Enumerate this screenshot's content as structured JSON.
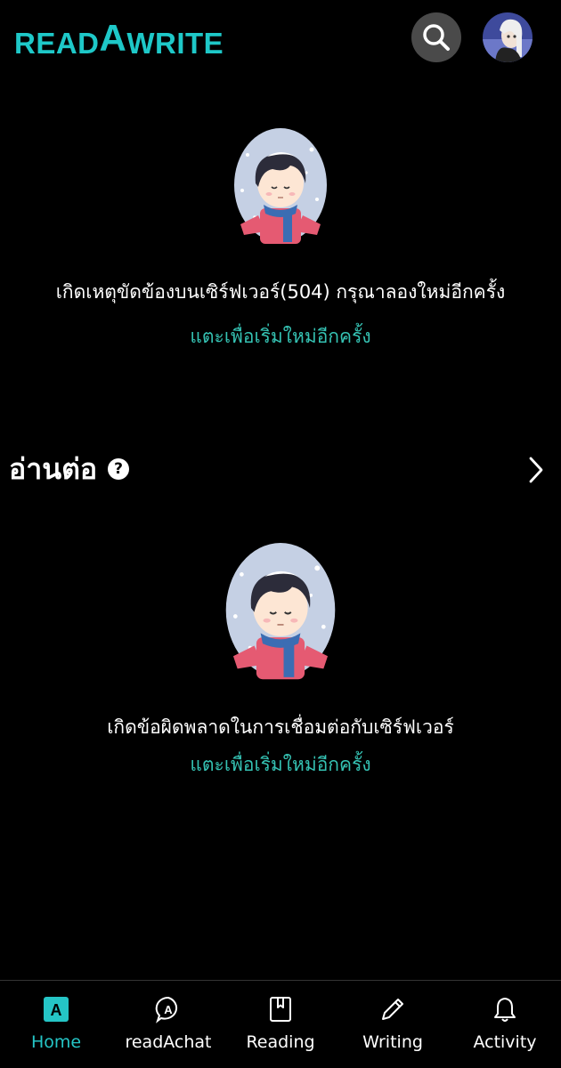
{
  "header": {
    "logo_prefix": "READ",
    "logo_a": "A",
    "logo_suffix": "WRITE",
    "search_icon": "search-icon",
    "avatar": "user-avatar"
  },
  "colors": {
    "brand": "#1ec8c8",
    "link": "#35c2b3",
    "background": "#000000"
  },
  "error_top": {
    "message": "เกิดเหตุขัดข้องบนเซิร์ฟเวอร์(504) กรุณาลองใหม่อีกครั้ง",
    "retry": "แตะเพื่อเริ่มใหม่อีกครั้ง"
  },
  "continue_reading": {
    "title": "อ่านต่อ",
    "help": "?"
  },
  "error_bottom": {
    "message": "เกิดข้อผิดพลาดในการเชื่อมต่อกับเซิร์ฟเวอร์",
    "retry": "แตะเพื่อเริ่มใหม่อีกครั้ง"
  },
  "nav": {
    "items": [
      {
        "label": "Home",
        "icon": "home-icon",
        "active": true
      },
      {
        "label": "readAchat",
        "icon": "chat-icon",
        "active": false
      },
      {
        "label": "Reading",
        "icon": "book-icon",
        "active": false
      },
      {
        "label": "Writing",
        "icon": "pencil-icon",
        "active": false
      },
      {
        "label": "Activity",
        "icon": "bell-icon",
        "active": false
      }
    ]
  }
}
